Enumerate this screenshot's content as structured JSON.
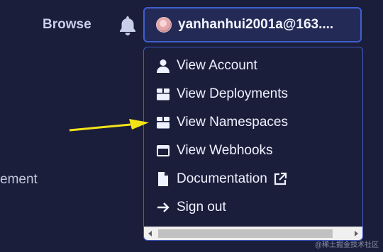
{
  "header": {
    "browse_label": "Browse",
    "notification_icon": "bell-icon",
    "account": {
      "avatar_icon": "avatar",
      "email": "yanhanhui2001a@163...."
    }
  },
  "background_text": "ement",
  "menu": {
    "items": [
      {
        "label": "View Account",
        "icon": "user-icon"
      },
      {
        "label": "View Deployments",
        "icon": "box-icon"
      },
      {
        "label": "View Namespaces",
        "icon": "box-icon"
      },
      {
        "label": "View Webhooks",
        "icon": "window-icon"
      },
      {
        "label": "Documentation",
        "icon": "file-icon",
        "trailing_icon": "external-link-icon"
      },
      {
        "label": "Sign out",
        "icon": "arrow-right-icon"
      }
    ]
  },
  "watermark": "@稀土掘金技术社区",
  "colors": {
    "background": "#1b1e3a",
    "accent_border": "#3e5fd0",
    "annotation_arrow": "#f5e31a"
  }
}
